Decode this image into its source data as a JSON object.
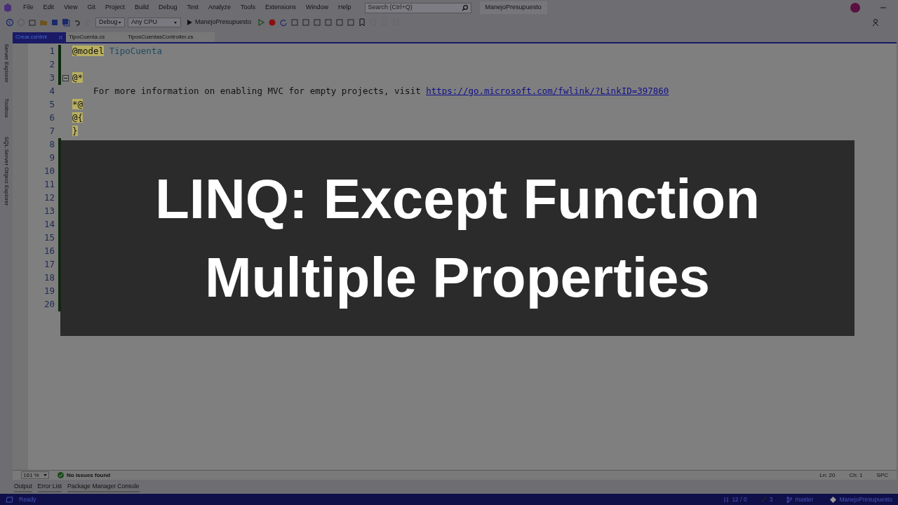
{
  "menu": [
    "File",
    "Edit",
    "View",
    "Git",
    "Project",
    "Build",
    "Debug",
    "Test",
    "Analyze",
    "Tools",
    "Extensions",
    "Window",
    "Help"
  ],
  "search": {
    "placeholder": "Search (Ctrl+Q)"
  },
  "solution_name": "ManejoPresupuesto",
  "toolbar": {
    "configuration": "Debug",
    "platform": "Any CPU",
    "run_target": "ManejoPresupuesto"
  },
  "tool_strip": [
    "Server Explorer",
    "Toolbox",
    "SQL Server Object Explorer"
  ],
  "tabs": [
    {
      "label": "Crear.cshtml",
      "selected": true
    },
    {
      "label": "TipoCuenta.cs",
      "selected": false
    },
    {
      "label": "TiposCuentasController.cs",
      "selected": false
    }
  ],
  "code_lines": [
    {
      "number": "1",
      "changed": true,
      "segments": [
        {
          "kind": "razor",
          "text": "@model"
        },
        {
          "kind": "type",
          "text": " TipoCuenta"
        }
      ]
    },
    {
      "number": "2",
      "changed": true
    },
    {
      "number": "3",
      "changed": true,
      "fold": true,
      "segments": [
        {
          "kind": "razor",
          "text": "@*"
        }
      ]
    },
    {
      "number": "4",
      "changed": false,
      "segments": [
        {
          "kind": "plain",
          "text": "    For more information on enabling MVC for empty projects, visit "
        },
        {
          "kind": "link",
          "text": "https://go.microsoft.com/fwlink/?LinkID=397860"
        }
      ]
    },
    {
      "number": "5",
      "changed": false,
      "segments": [
        {
          "kind": "razor",
          "text": "*@"
        }
      ]
    },
    {
      "number": "6",
      "changed": false,
      "segments": [
        {
          "kind": "razor",
          "text": "@{"
        }
      ]
    },
    {
      "number": "7",
      "changed": false,
      "segments": [
        {
          "kind": "razor",
          "text": "}"
        }
      ]
    },
    {
      "number": "8",
      "changed": true
    },
    {
      "number": "9",
      "changed": true
    },
    {
      "number": "10",
      "changed": true
    },
    {
      "number": "11",
      "changed": true
    },
    {
      "number": "12",
      "changed": true
    },
    {
      "number": "13",
      "changed": true
    },
    {
      "number": "14",
      "changed": true
    },
    {
      "number": "15",
      "changed": true
    },
    {
      "number": "16",
      "changed": true
    },
    {
      "number": "17",
      "changed": true
    },
    {
      "number": "18",
      "changed": true
    },
    {
      "number": "19",
      "changed": true
    },
    {
      "number": "20",
      "changed": true
    }
  ],
  "editor_status": {
    "zoom": "161 %",
    "issues": "No issues found",
    "line": "Ln: 20",
    "column": "Ch: 1",
    "whitespace": "SPC"
  },
  "bottom_tabs": [
    "Output",
    "Error List",
    "Package Manager Console"
  ],
  "status_bar": {
    "state": "Ready",
    "changes": "12 / 0",
    "edits": "3",
    "branch": "master",
    "repository": "ManejoPresupuesto"
  },
  "banner": {
    "lines": [
      "LINQ: Except Function",
      "Multiple Properties"
    ]
  }
}
